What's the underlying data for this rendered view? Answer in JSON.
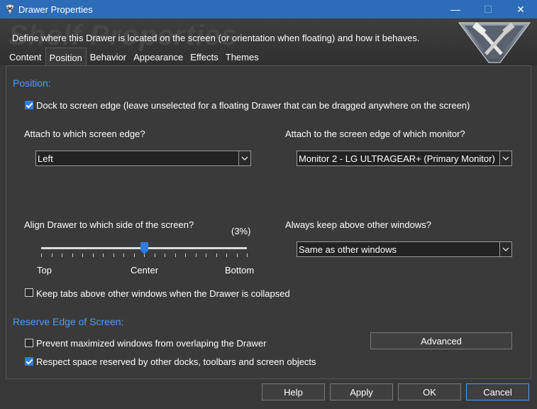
{
  "window": {
    "title": "Drawer Properties",
    "minimize": "—",
    "maximize": "☐",
    "close": "✕"
  },
  "header": {
    "watermark": "Shelf Properties",
    "description": "Define where this Drawer is located on the screen (or orientation when floating) and how it behaves."
  },
  "tabs": [
    {
      "label": "Content",
      "active": false
    },
    {
      "label": "Position",
      "active": true
    },
    {
      "label": "Behavior",
      "active": false
    },
    {
      "label": "Appearance",
      "active": false
    },
    {
      "label": "Effects",
      "active": false
    },
    {
      "label": "Themes",
      "active": false
    }
  ],
  "position": {
    "section_title": "Position:",
    "dock_checkbox": {
      "label": "Dock to screen edge (leave unselected for a floating Drawer that can be dragged anywhere on the screen)",
      "checked": true
    },
    "edge_label": "Attach to which screen edge?",
    "edge_value": "Left",
    "monitor_label": "Attach to the screen edge of which monitor?",
    "monitor_value": "Monitor 2 - LG ULTRAGEAR+ (Primary Monitor)",
    "align_label": "Align Drawer to which side of the screen?",
    "align_percent": "(3%)",
    "align_value": 0.5,
    "align_ticks": {
      "top": "Top",
      "center": "Center",
      "bottom": "Bottom"
    },
    "above_label": "Always keep above other windows?",
    "above_value": "Same as other windows",
    "tabs_checkbox": {
      "label": "Keep tabs above other windows when the Drawer is collapsed",
      "checked": false
    }
  },
  "reserve": {
    "section_title": "Reserve Edge of Screen:",
    "prevent_checkbox": {
      "label": "Prevent maximized windows from overlaping the Drawer",
      "checked": false
    },
    "respect_checkbox": {
      "label": "Respect space reserved by other docks, toolbars and screen objects",
      "checked": true
    },
    "advanced_label": "Advanced"
  },
  "footer": {
    "help": "Help",
    "apply": "Apply",
    "ok": "OK",
    "cancel": "Cancel"
  },
  "colors": {
    "accent": "#4a9eff",
    "titlebar": "#2c6cb8",
    "background": "#383838"
  }
}
